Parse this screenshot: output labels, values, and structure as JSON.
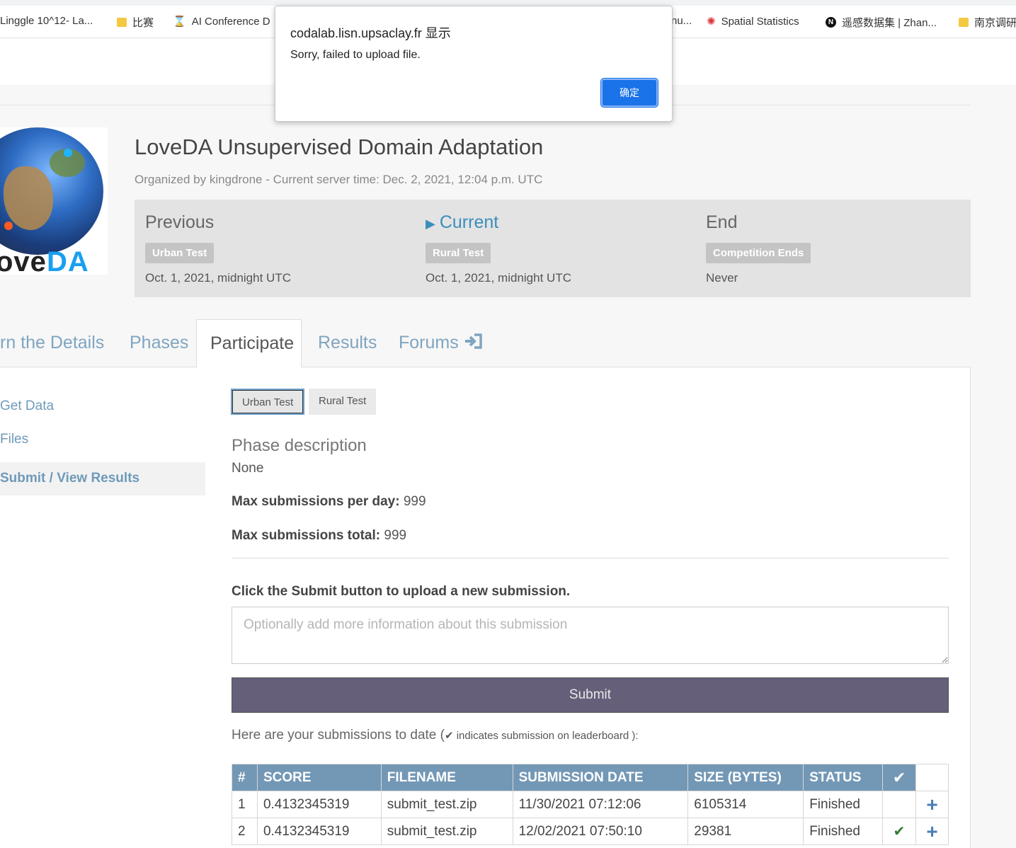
{
  "bookmarks": [
    {
      "label": "Linggle 10^12- La...",
      "icon": "page-icon"
    },
    {
      "label": "比赛",
      "icon": "folder-icon"
    },
    {
      "label": "AI Conference D",
      "icon": "hourglass-icon"
    },
    {
      "label": "nu...",
      "icon": ""
    },
    {
      "label": "Spatial Statistics",
      "icon": "spatial-stats-icon"
    },
    {
      "label": "遥感数据集 | Zhan...",
      "icon": "notion-icon"
    },
    {
      "label": "南京调研",
      "icon": "folder-icon"
    }
  ],
  "dialog": {
    "origin": "codalab.lisn.upsaclay.fr 显示",
    "message": "Sorry, failed to upload file.",
    "ok_label": "确定"
  },
  "competition": {
    "logo_text_prefix": "ove",
    "logo_text_suffix": "DA",
    "title": "LoveDA Unsupervised Domain Adaptation",
    "subtitle": "Organized by kingdrone - Current server time: Dec. 2, 2021, 12:04 p.m. UTC"
  },
  "phases": [
    {
      "heading": "Previous",
      "badge": "Urban Test",
      "date": "Oct. 1, 2021, midnight UTC",
      "current": false
    },
    {
      "heading": "Current",
      "badge": "Rural Test",
      "date": "Oct. 1, 2021, midnight UTC",
      "current": true
    },
    {
      "heading": "End",
      "badge": "Competition Ends",
      "date": "Never",
      "current": false
    }
  ],
  "tabs": {
    "details": "rn the Details",
    "phases": "Phases",
    "participate": "Participate",
    "results": "Results",
    "forums": "Forums"
  },
  "sidebar": {
    "items": [
      "Get Data",
      "Files",
      "Submit / View Results"
    ]
  },
  "phase_buttons": [
    "Urban Test",
    "Rural Test"
  ],
  "phase_info": {
    "description_title": "Phase description",
    "description_value": "None",
    "max_day_label": "Max submissions per day:",
    "max_day_value": "999",
    "max_total_label": "Max submissions total:",
    "max_total_value": "999"
  },
  "submit_section": {
    "label": "Click the Submit button to upload a new submission.",
    "placeholder": "Optionally add more information about this submission",
    "button": "Submit",
    "note_prefix": "Here are your submissions to date (",
    "note_small": " indicates submission on leaderboard ):"
  },
  "table": {
    "headers": [
      "#",
      "SCORE",
      "FILENAME",
      "SUBMISSION DATE",
      "SIZE (BYTES)",
      "STATUS"
    ],
    "rows": [
      {
        "num": "1",
        "score": "0.4132345319",
        "filename": "submit_test.zip",
        "date": "11/30/2021 07:12:06",
        "size": "6105314",
        "status": "Finished",
        "on_leaderboard": false
      },
      {
        "num": "2",
        "score": "0.4132345319",
        "filename": "submit_test.zip",
        "date": "12/02/2021 07:50:10",
        "size": "29381",
        "status": "Finished",
        "on_leaderboard": true
      }
    ]
  },
  "colors": {
    "accent": "#3c8dbc",
    "link": "#7fa5c0",
    "table_header": "#7398b6",
    "submit_bg": "#665f7a",
    "dialog_button": "#1a73e8"
  }
}
